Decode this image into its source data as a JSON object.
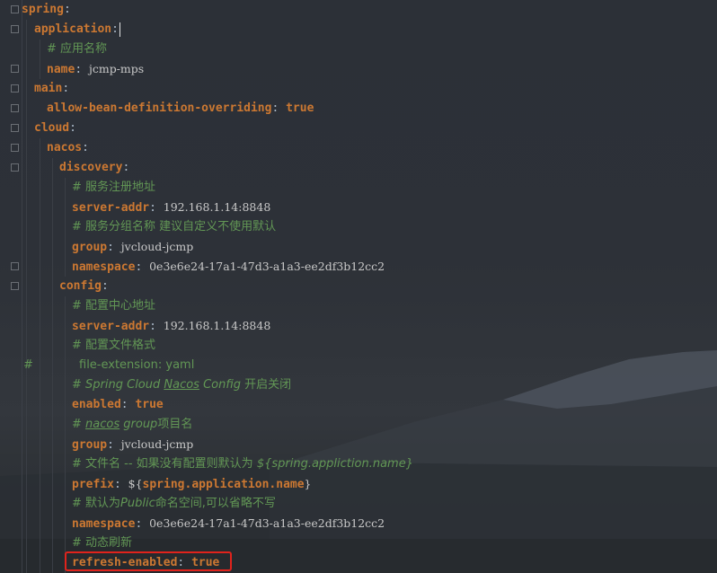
{
  "lines": [
    {
      "key": "spring",
      "sep": ":"
    },
    {
      "key": "application",
      "sep": ":"
    },
    {
      "comment": "# 应用名称"
    },
    {
      "key": "name",
      "sep": ": ",
      "value": "jcmp-mps"
    },
    {
      "key": "main",
      "sep": ":"
    },
    {
      "key": "allow-bean-definition-overriding",
      "sep": ": ",
      "value": "true"
    },
    {
      "key": "cloud",
      "sep": ":"
    },
    {
      "key": "nacos",
      "sep": ":"
    },
    {
      "key": "discovery",
      "sep": ":"
    },
    {
      "comment": "# 服务注册地址"
    },
    {
      "key": "server-addr",
      "sep": ": ",
      "value": "192.168.1.14:8848"
    },
    {
      "comment": "# 服务分组名称 建议自定义不使用默认"
    },
    {
      "key": "group",
      "sep": ": ",
      "value": "jvcloud-jcmp"
    },
    {
      "key": "namespace",
      "sep": ": ",
      "value": "0e3e6e24-17a1-47d3-a1a3-ee2df3b12cc2"
    },
    {
      "key": "config",
      "sep": ":"
    },
    {
      "comment": "# 配置中心地址"
    },
    {
      "key": "server-addr",
      "sep": ": ",
      "value": "192.168.1.14:8848"
    },
    {
      "comment": "# 配置文件格式"
    },
    {
      "line_comment_mark": "#",
      "comment": "file-extension: yaml"
    },
    {
      "comment_parts": [
        "# ",
        "Spring Cloud ",
        "Nacos",
        " Config ",
        "开启关闭"
      ]
    },
    {
      "key": "enabled",
      "sep": ": ",
      "value": "true"
    },
    {
      "comment_parts": [
        "# ",
        "nacos",
        " ",
        "group",
        "项目名"
      ]
    },
    {
      "key": "group",
      "sep": ": ",
      "value": "jvcloud-jcmp"
    },
    {
      "comment_parts": [
        "# 文件名 -- 如果没有配置则默认为 ",
        "${spring.appliction.name}"
      ]
    },
    {
      "key": "prefix",
      "sep": ": ",
      "value_prefix": "${",
      "placeholder": "spring.application.name",
      "value_suffix": "}"
    },
    {
      "comment_parts": [
        "# 默认为",
        "Public",
        "命名空间,可以省略不写"
      ]
    },
    {
      "key": "namespace",
      "sep": ": ",
      "value": "0e3e6e24-17a1-47d3-a1a3-ee2df3b12cc2"
    },
    {
      "comment": "# 动态刷新"
    },
    {
      "key": "refresh-enabled",
      "sep": ": ",
      "value": "true"
    }
  ],
  "colors": {
    "key": "#cc7832",
    "comment": "#629755",
    "value": "#c8c8c8",
    "highlight": "#e0231c"
  },
  "icons": {
    "fold": "fold-marker-icon"
  }
}
